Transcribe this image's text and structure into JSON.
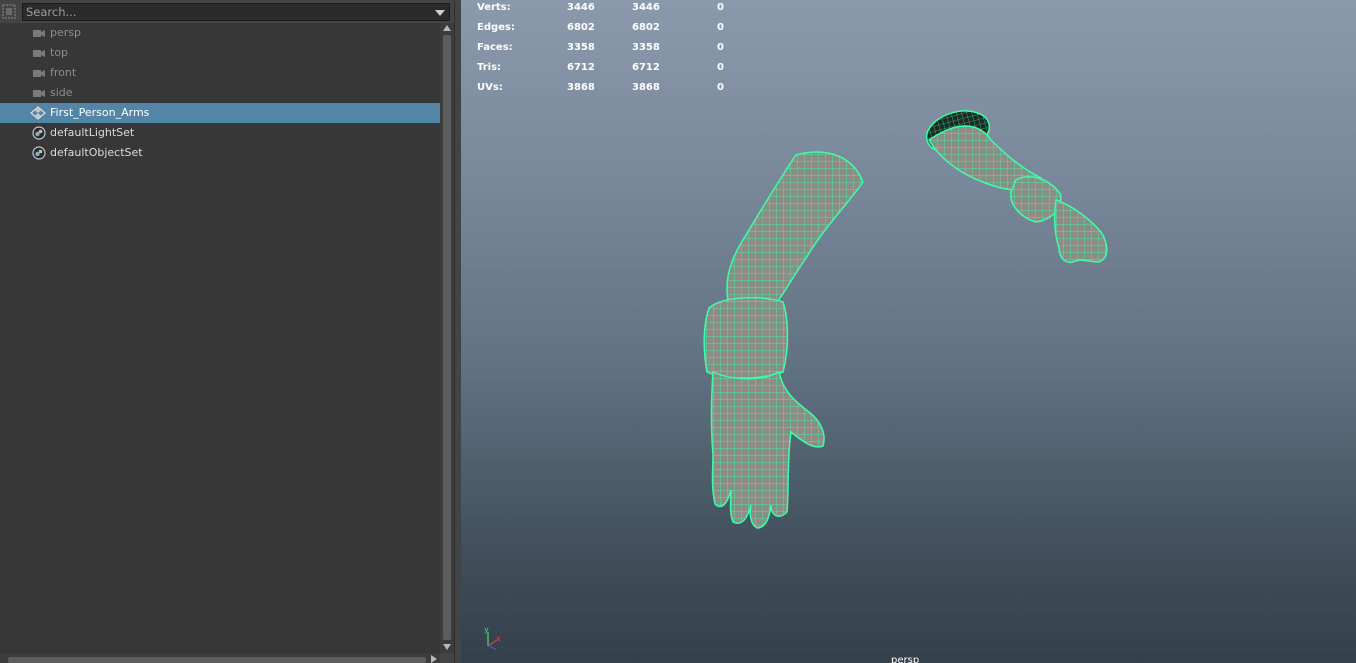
{
  "outliner": {
    "search_placeholder": "Search...",
    "items": [
      {
        "label": "persp",
        "icon": "camera-icon",
        "dim": true,
        "selected": false
      },
      {
        "label": "top",
        "icon": "camera-icon",
        "dim": true,
        "selected": false
      },
      {
        "label": "front",
        "icon": "camera-icon",
        "dim": true,
        "selected": false
      },
      {
        "label": "side",
        "icon": "camera-icon",
        "dim": true,
        "selected": false
      },
      {
        "label": "First_Person_Arms",
        "icon": "mesh-group-icon",
        "dim": false,
        "selected": true
      },
      {
        "label": "defaultLightSet",
        "icon": "object-set-icon",
        "dim": false,
        "selected": false
      },
      {
        "label": "defaultObjectSet",
        "icon": "object-set-icon",
        "dim": false,
        "selected": false
      }
    ]
  },
  "viewport": {
    "hud": [
      {
        "label": "Verts:",
        "v1": "3446",
        "v2": "3446",
        "v3": "0"
      },
      {
        "label": "Edges:",
        "v1": "6802",
        "v2": "6802",
        "v3": "0"
      },
      {
        "label": "Faces:",
        "v1": "3358",
        "v2": "3358",
        "v3": "0"
      },
      {
        "label": "Tris:",
        "v1": "6712",
        "v2": "6712",
        "v3": "0"
      },
      {
        "label": "UVs:",
        "v1": "3868",
        "v2": "3868",
        "v3": "0"
      }
    ],
    "camera_label": "persp",
    "axis": {
      "y_label": "y",
      "x_label": "x"
    },
    "colors": {
      "wireframe": "#3dffa8",
      "selection_highlight": "#5285a6"
    }
  }
}
